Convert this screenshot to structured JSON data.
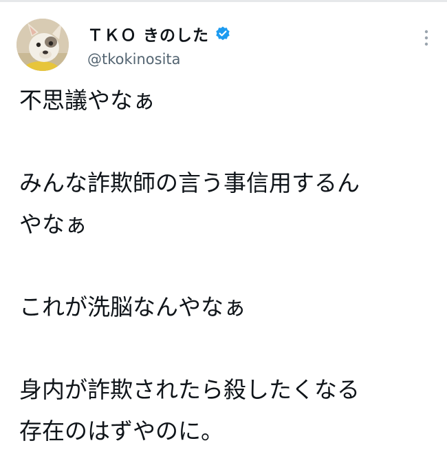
{
  "author": {
    "display_name": "ＴＫＯ きのした",
    "handle": "@tkokinosita",
    "verified": true,
    "avatar_icon": "french-bulldog-avatar"
  },
  "colors": {
    "text_primary": "#0f1419",
    "text_secondary": "#536471",
    "verified_blue": "#1d9bf0",
    "divider": "#e6e8ea"
  },
  "menu": {
    "icon": "more-vertical-icon"
  },
  "tweet": {
    "lines": [
      "不思議やなぁ",
      "",
      "みんな詐欺師の言う事信用するん",
      "やなぁ",
      "",
      "これが洗脳なんやなぁ",
      "",
      "身内が詐欺されたら殺したくなる",
      "存在のはずやのに。"
    ]
  }
}
